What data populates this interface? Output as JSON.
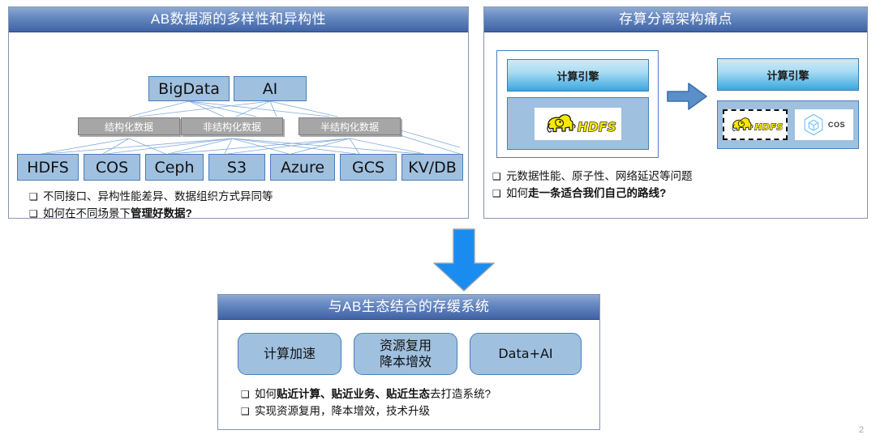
{
  "slide": {
    "page_number": "2"
  },
  "panels": {
    "sources": {
      "title": "AB数据源的多样性和异构性",
      "top_nodes": [
        {
          "label": "BigData"
        },
        {
          "label": "AI"
        }
      ],
      "mid_nodes": [
        {
          "label": "结构化数据"
        },
        {
          "label": "非结构化数据"
        },
        {
          "label": "半结构化数据"
        }
      ],
      "leaf_nodes": [
        {
          "label": "HDFS"
        },
        {
          "label": "COS"
        },
        {
          "label": "Ceph"
        },
        {
          "label": "S3"
        },
        {
          "label": "Azure"
        },
        {
          "label": "GCS"
        },
        {
          "label": "KV/DB"
        }
      ],
      "bullets": [
        {
          "mark": "❑",
          "plain": "不同接口、异构性能差异、数据组织方式异同等",
          "bold": ""
        },
        {
          "mark": "❑",
          "plain": "如何在不同场景下",
          "bold": "管理好数据?"
        }
      ]
    },
    "pain": {
      "title": "存算分离架构痛点",
      "left_group": {
        "engine_label": "计算引擎",
        "storage_logo": "hdfs-logo"
      },
      "right_group": {
        "engine_label": "计算引擎",
        "storage_logos": [
          "hdfs-logo",
          "cos-logo"
        ],
        "cos_label": "COS"
      },
      "transition_arrow": "arrow-right-icon",
      "bullets": [
        {
          "mark": "❑",
          "plain": "元数据性能、原子性、网络延迟等问题",
          "bold": ""
        },
        {
          "mark": "❑",
          "plain": "如何",
          "bold": "走一条适合我们自己的路线?"
        }
      ]
    },
    "cache": {
      "title": "与AB生态结合的存缓系统",
      "pills": [
        {
          "lines": [
            "计算加速"
          ]
        },
        {
          "lines": [
            "资源复用",
            "降本增效"
          ]
        },
        {
          "lines": [
            "Data+AI"
          ]
        }
      ],
      "bullets": [
        {
          "mark": "❑",
          "prefix": "如何",
          "bold": "贴近计算、贴近业务、贴近生态",
          "suffix": "去打造系统?"
        },
        {
          "mark": "❑",
          "prefix": "实现资源复用，降本增效，技术升级",
          "bold": "",
          "suffix": ""
        }
      ]
    }
  },
  "flow": {
    "down_arrow": "arrow-down-icon"
  },
  "colors": {
    "title_bar_light": "#8ea9d3",
    "title_bar_dark": "#3f63a5",
    "node_blue": "#9fc0df",
    "node_border": "#4a7ebb",
    "grey_node": "#a6a6a6",
    "engine_cyan": "#3aa6e0",
    "big_arrow": "#1a8cf0",
    "small_arrow": "#5b8fc9"
  }
}
